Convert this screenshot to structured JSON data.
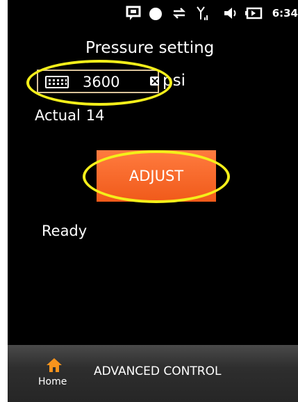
{
  "status_bar": {
    "icons": [
      "chat-icon",
      "record-icon",
      "sync-icon",
      "signal-icon",
      "volume-icon",
      "battery-icon"
    ],
    "time": "6:34"
  },
  "title": "Pressure setting",
  "pressure_input": {
    "value": "3600",
    "unit": "psi"
  },
  "actual": {
    "label": "Actual",
    "value": "14"
  },
  "adjust_button": "ADJUST",
  "status": "Ready",
  "bottom_bar": {
    "home_label": "Home",
    "advanced_label": "ADVANCED CONTROL"
  },
  "colors": {
    "button": "#f26522",
    "highlight": "#f5ef1a",
    "background": "#000000"
  }
}
